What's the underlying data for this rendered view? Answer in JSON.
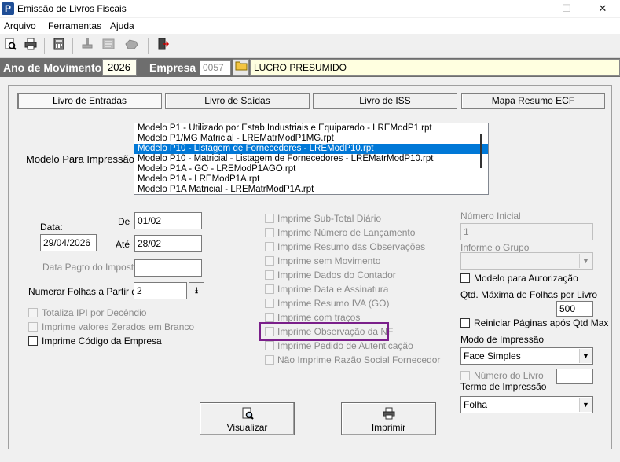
{
  "window": {
    "title": "Emissão de Livros Fiscais",
    "app_icon": "P",
    "minimize": "—",
    "maximize": "☐",
    "close": "✕"
  },
  "menu": [
    "Arquivo",
    "Ferramentas",
    "Ajuda"
  ],
  "toolbar_icons": [
    "preview-icon",
    "print-icon",
    "calculator-icon",
    "stamp-icon",
    "document-icon",
    "hand-icon",
    "exit-door-icon"
  ],
  "header": {
    "ano_label": "Ano de Movimento",
    "ano_value": "2026",
    "empresa_label": "Empresa",
    "empresa_code": "0057",
    "empresa_name": "LUCRO PRESUMIDO"
  },
  "tabs": [
    "Livro de Entradas",
    "Livro de Saídas",
    "Livro de ISS",
    "Mapa Resumo ECF"
  ],
  "modelo": {
    "label": "Modelo Para Impressão",
    "items": [
      "Modelo P1 - Utilizado por Estab.Industriais e Equiparado - LREModP1.rpt",
      "Modelo P1/MG Matricial - LREMatrModP1MG.rpt",
      "Modelo P10 - Listagem de Fornecedores - LREModP10.rpt",
      "Modelo P10 - Matricial - Listagem de Fornecedores - LREMatrModP10.rpt",
      "Modelo P1A - GO - LREModP1AGO.rpt",
      "Modelo P1A - LREModP1A.rpt",
      "Modelo P1A Matricial - LREMatrModP1A.rpt"
    ],
    "selected_index": 2
  },
  "datas": {
    "data_label": "Data:",
    "data_value": "29/04/2026",
    "de_label": "De",
    "de_value": "01/02",
    "ate_label": "Até",
    "ate_value": "28/02",
    "pagto_label": "Data Pagto do Imposto",
    "pagto_value": ""
  },
  "numerar": {
    "label": "Numerar Folhas a Partir de",
    "value": "2"
  },
  "left_checks": [
    {
      "label": "Totaliza IPI por Decêndio",
      "enabled": false,
      "checked": false
    },
    {
      "label": "Imprime valores Zerados em Branco",
      "enabled": false,
      "checked": false
    },
    {
      "label": "Imprime Código da Empresa",
      "enabled": true,
      "checked": false
    }
  ],
  "middle_checks": [
    {
      "label": "Imprime Sub-Total Diário"
    },
    {
      "label": "Imprime Número de Lançamento"
    },
    {
      "label": "Imprime Resumo das Observações"
    },
    {
      "label": "Imprime sem Movimento"
    },
    {
      "label": "Imprime Dados do Contador"
    },
    {
      "label": "Imprime Data e Assinatura"
    },
    {
      "label": "Imprime Resumo IVA (GO)"
    },
    {
      "label": "Imprime com traços"
    },
    {
      "label": "Imprime Observação da NF"
    },
    {
      "label": "Imprime Pedido de Autenticação"
    },
    {
      "label": "Não Imprime Razão Social Fornecedor"
    }
  ],
  "right": {
    "numero_inicial_label": "Número Inicial",
    "numero_inicial_value": "1",
    "informe_grupo_label": "Informe o Grupo",
    "informe_grupo_value": "",
    "modelo_autorizacao_label": "Modelo para Autorização",
    "qtd_max_label": "Qtd. Máxima de Folhas por Livro",
    "qtd_max_value": "500",
    "reiniciar_label": "Reiniciar Páginas após Qtd Max",
    "modo_label": "Modo de Impressão",
    "modo_value": "Face Simples",
    "numero_livro_label": "Número do Livro",
    "numero_livro_value": "",
    "termo_label": "Termo de Impressão",
    "termo_value": "Folha"
  },
  "buttons": {
    "visualizar": "Visualizar",
    "imprimir": "Imprimir"
  },
  "colors": {
    "selection": "#0078d7",
    "highlight_border": "#7a1f8a",
    "header_bg": "#6e6e6e"
  }
}
